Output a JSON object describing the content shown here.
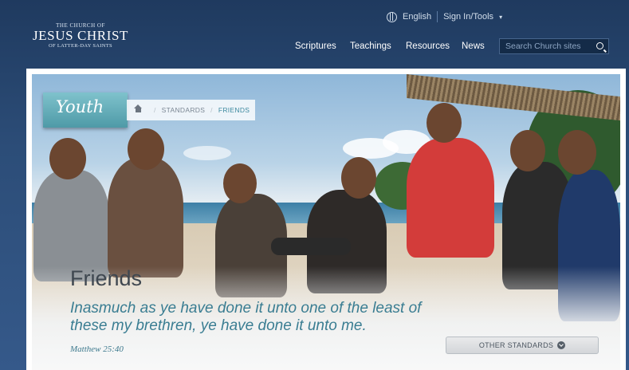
{
  "header": {
    "logo": {
      "line1": "THE CHURCH OF",
      "line2": "JESUS CHRIST",
      "line3": "OF LATTER-DAY SAINTS"
    },
    "language": "English",
    "sign_in": "Sign In/Tools",
    "nav": [
      "Scriptures",
      "Teachings",
      "Resources",
      "News"
    ],
    "search_placeholder": "Search Church sites"
  },
  "hero": {
    "section_tab": "Youth",
    "breadcrumb": [
      "STANDARDS",
      "FRIENDS"
    ],
    "title": "Friends",
    "quote": "Inasmuch as ye have done it unto one of the least of these my brethren, ye have done it unto me.",
    "reference": "Matthew 25:40",
    "other_button": "OTHER STANDARDS"
  },
  "colors": {
    "header_bg": "#2c4d78",
    "accent_teal": "#3a7d92",
    "youth_tab": "#5fa8b4"
  }
}
